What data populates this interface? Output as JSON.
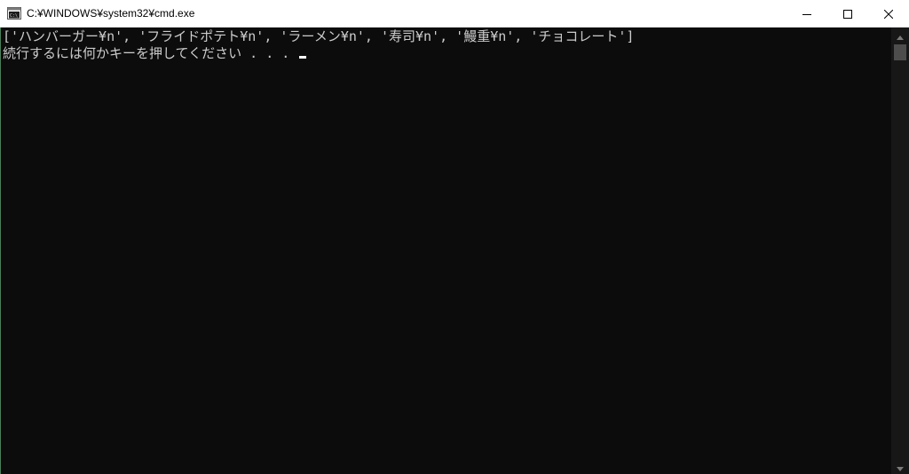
{
  "window": {
    "title": "C:¥WINDOWS¥system32¥cmd.exe",
    "icon": "cmd-icon"
  },
  "controls": {
    "minimize_icon": "minimize-icon",
    "maximize_icon": "maximize-icon",
    "close_icon": "close-icon"
  },
  "console": {
    "lines": [
      "['ハンバーガー¥n', 'フライドポテト¥n', 'ラーメン¥n', '寿司¥n', '鰻重¥n', 'チョコレート']",
      "続行するには何かキーを押してください . . . "
    ],
    "text_color": "#cccccc",
    "background": "#0c0c0c"
  },
  "scrollbar": {
    "up_icon": "scroll-up-arrow-icon",
    "down_icon": "scroll-down-arrow-icon"
  }
}
